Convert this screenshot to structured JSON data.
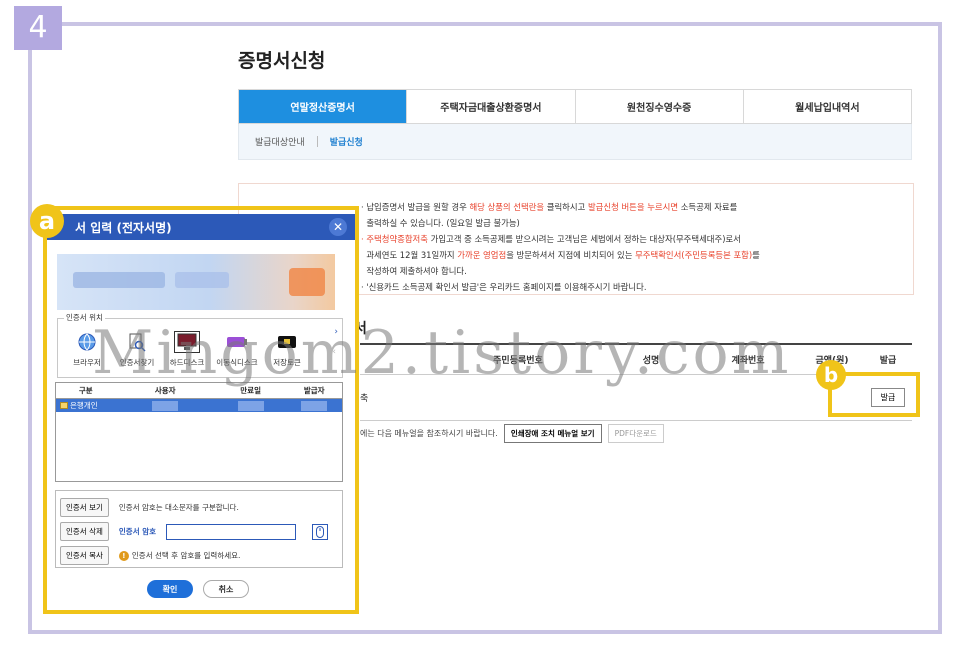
{
  "step_number": "4",
  "page": {
    "title": "증명서신청",
    "tabs": [
      "연말정산증명서",
      "주택자금대출상환증명서",
      "원천징수영수증",
      "월세납입내역서"
    ],
    "active_tab": 0,
    "subtabs": [
      "발급대상안내",
      "발급신청"
    ],
    "active_subtab": 1
  },
  "notice": {
    "l1_a": "· 납입증명서 발급을 원할 경우 ",
    "l1_b": "해당 상품의 선택란을",
    "l1_c": " 클릭하시고 ",
    "l1_d": "발급신청 버튼을 누르시면",
    "l1_e": " 소득공제 자료를",
    "l2": "출력하실 수 있습니다. (일요일 발급 불가능)",
    "l3_a": "· 주택청약종합저축",
    "l3_b": " 가입고객 중 소득공제를 받으시려는 고객님은 세법에서 정하는 대상자(무주택세대주)로서",
    "l4_a": "과세연도 12월 31일까지 ",
    "l4_b": "가까운 영업점",
    "l4_c": "을 방문하셔서 지점에 비치되어 있는 ",
    "l4_d": "무주택확인서(주민등록등본 포함)",
    "l4_e": "를",
    "l5": "작성하여 제출하셔야 합니다.",
    "l6": "· '신용카드 소득공제 확인서 발급'은 우리카드 홈페이지를 이용해주시기 바랍니다."
  },
  "section_title": "서",
  "table": {
    "headers": [
      "",
      "주민등록번호",
      "성명",
      "계좌번호",
      "금액(원)",
      "발급"
    ],
    "row_first": "축",
    "issue_button": "발급"
  },
  "help": {
    "text": "에는 다음 메뉴얼을 참조하시기 바랍니다.",
    "manual_button": "인쇄장애 조치 메뉴얼 보기",
    "pdf_button": "PDF다운로드"
  },
  "dialog": {
    "title": "서 입력 (전자서명)",
    "location_legend": "인증서 위치",
    "locations": [
      "브라우저",
      "인증서찾기",
      "하드디스크",
      "이동식디스크",
      "저장토큰"
    ],
    "selected_location": 2,
    "cert_headers": [
      "구분",
      "사용자",
      "만료일",
      "발급자"
    ],
    "cert_row_type": "은행개인",
    "view_button": "인증서 보기",
    "delete_button": "인증서 삭제",
    "copy_button": "인증서 복사",
    "case_note": "인증서 암호는 대소문자를 구분합니다.",
    "password_label": "인증서 암호",
    "password_value": "",
    "warning": "인증서 선택 후 암호를 입력하세요.",
    "ok_button": "확인",
    "cancel_button": "취소"
  },
  "badges": {
    "a": "a",
    "b": "b"
  },
  "watermark": "Mingom2.tistory.com",
  "colors": {
    "accent": "#1e8fe0",
    "dialog_header": "#2c59b8",
    "highlight": "#f0c419",
    "frame": "#c9c4e4",
    "notice_red": "#e8402a"
  }
}
